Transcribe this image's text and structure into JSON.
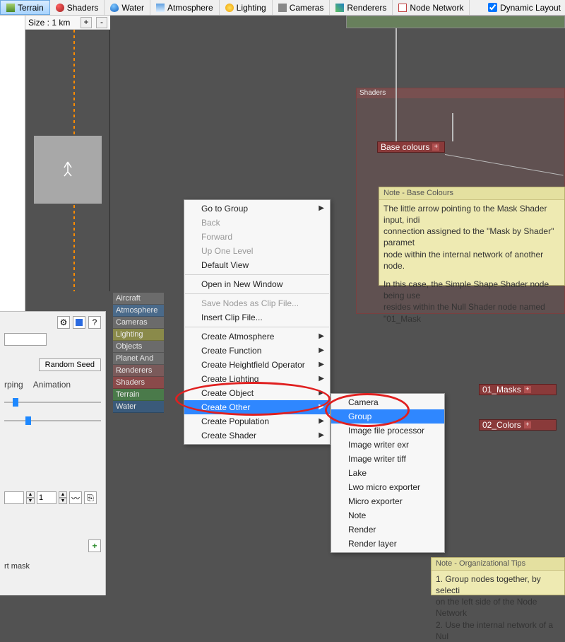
{
  "toolbar": {
    "tabs": [
      {
        "label": "Terrain",
        "selected": true,
        "icon": "terrain"
      },
      {
        "label": "Shaders",
        "icon": "shader"
      },
      {
        "label": "Water",
        "icon": "water"
      },
      {
        "label": "Atmosphere",
        "icon": "atmosphere"
      },
      {
        "label": "Lighting",
        "icon": "lighting"
      },
      {
        "label": "Cameras",
        "icon": "camera"
      },
      {
        "label": "Renderers",
        "icon": "renderer"
      },
      {
        "label": "Node Network",
        "icon": "network"
      }
    ],
    "dynamic_layout_label": "Dynamic Layout",
    "dynamic_layout_checked": true
  },
  "subbar": {
    "size_label": "Size : 1 km",
    "plus": "+",
    "minus": "-"
  },
  "categories": [
    {
      "label": "Aircraft",
      "cls": "aircraft"
    },
    {
      "label": "Atmosphere",
      "cls": "atmosphere"
    },
    {
      "label": "Cameras",
      "cls": "cameras"
    },
    {
      "label": "Lighting",
      "cls": "lighting"
    },
    {
      "label": "Objects",
      "cls": "objects"
    },
    {
      "label": "Planet And ...",
      "cls": "planet"
    },
    {
      "label": "Renderers",
      "cls": "renderers"
    },
    {
      "label": "Shaders",
      "cls": "shaders"
    },
    {
      "label": "Terrain",
      "cls": "terrain"
    },
    {
      "label": "Water",
      "cls": "water"
    }
  ],
  "prop": {
    "random_seed_label": "Random Seed",
    "tab_warp": "rping",
    "tab_anim": "Animation",
    "stepper_value": "1",
    "mask_label": "rt mask",
    "help_glyph": "?",
    "gear_glyph": "⚙"
  },
  "menu1": [
    {
      "label": "Go to Group",
      "sub": true
    },
    {
      "label": "Back",
      "disabled": true
    },
    {
      "label": "Forward",
      "disabled": true
    },
    {
      "label": "Up One Level",
      "disabled": true
    },
    {
      "label": "Default View"
    },
    {
      "sep": true
    },
    {
      "label": "Open in New Window"
    },
    {
      "sep": true
    },
    {
      "label": "Save Nodes as Clip File...",
      "disabled": true
    },
    {
      "label": "Insert Clip File..."
    },
    {
      "sep": true
    },
    {
      "label": "Create Atmosphere",
      "sub": true
    },
    {
      "label": "Create Function",
      "sub": true
    },
    {
      "label": "Create Heightfield Operator",
      "sub": true
    },
    {
      "label": "Create Lighting",
      "sub": true
    },
    {
      "label": "Create Object",
      "sub": true
    },
    {
      "label": "Create Other",
      "sub": true,
      "highlight": true
    },
    {
      "label": "Create Population",
      "sub": true
    },
    {
      "label": "Create Shader",
      "sub": true
    }
  ],
  "menu2": [
    {
      "label": "Camera"
    },
    {
      "label": "Group",
      "highlight": true
    },
    {
      "label": "Image file processor"
    },
    {
      "label": "Image writer exr"
    },
    {
      "label": "Image writer tiff"
    },
    {
      "label": "Lake"
    },
    {
      "label": "Lwo micro exporter"
    },
    {
      "label": "Micro exporter"
    },
    {
      "label": "Note"
    },
    {
      "label": "Render"
    },
    {
      "label": "Render layer"
    }
  ],
  "network": {
    "shaders_group_title": "Shaders",
    "base_colours_node": "Base colours",
    "masks_node": "01_Masks",
    "colors_node": "02_Colors"
  },
  "note1": {
    "header": "Note - Base Colours",
    "line1": "The little arrow pointing to the Mask Shader input, indi",
    "line2": "connection assigned to the \"Mask by Shader\" paramet",
    "line3": "node within the internal network of another node.",
    "line5": "In this case, the Simple Shape Shader node being use",
    "line6": "resides within the Null Shader node named \"01_Mask"
  },
  "note2": {
    "header": "Note - Organizational Tips",
    "line1": "1. Group nodes together, by selecti",
    "line2": "on the left side of the Node Network",
    "line3": "2. Use the internal network of a Nul"
  }
}
